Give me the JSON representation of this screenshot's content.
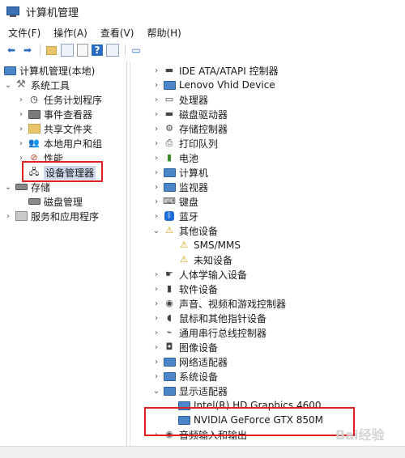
{
  "window": {
    "title": "计算机管理"
  },
  "menu": [
    "文件(F)",
    "操作(A)",
    "查看(V)",
    "帮助(H)"
  ],
  "toolbar_icons": [
    "back-arrow-icon",
    "forward-arrow-icon",
    "up-folder-icon",
    "show-tree-icon",
    "properties-icon",
    "help-icon",
    "action-pane-icon",
    "extra-icon"
  ],
  "left_tree": {
    "root": "计算机管理(本地)",
    "system_tools": "系统工具",
    "items": [
      "任务计划程序",
      "事件查看器",
      "共享文件夹",
      "本地用户和组",
      "性能",
      "设备管理器"
    ],
    "storage": "存储",
    "disk_management": "磁盘管理",
    "services": "服务和应用程序"
  },
  "device_tree": [
    {
      "label": "IDE ATA/ATAPI 控制器"
    },
    {
      "label": "Lenovo Vhid Device"
    },
    {
      "label": "处理器"
    },
    {
      "label": "磁盘驱动器"
    },
    {
      "label": "存储控制器"
    },
    {
      "label": "打印队列"
    },
    {
      "label": "电池"
    },
    {
      "label": "计算机"
    },
    {
      "label": "监视器"
    },
    {
      "label": "键盘"
    },
    {
      "label": "蓝牙"
    },
    {
      "label": "其他设备"
    },
    {
      "label": "SMS/MMS"
    },
    {
      "label": "未知设备"
    },
    {
      "label": "人体学输入设备"
    },
    {
      "label": "软件设备"
    },
    {
      "label": "声音、视频和游戏控制器"
    },
    {
      "label": "鼠标和其他指针设备"
    },
    {
      "label": "通用串行总线控制器"
    },
    {
      "label": "图像设备"
    },
    {
      "label": "网络适配器"
    },
    {
      "label": "系统设备"
    },
    {
      "label": "显示适配器"
    },
    {
      "label": "Intel(R) HD Graphics 4600"
    },
    {
      "label": "NVIDIA GeForce GTX 850M"
    },
    {
      "label": "音频输入和输出"
    }
  ],
  "watermark": "Bai经验",
  "colors": {
    "annotation_red": "#e02020",
    "selection": "#ccd8ea"
  }
}
